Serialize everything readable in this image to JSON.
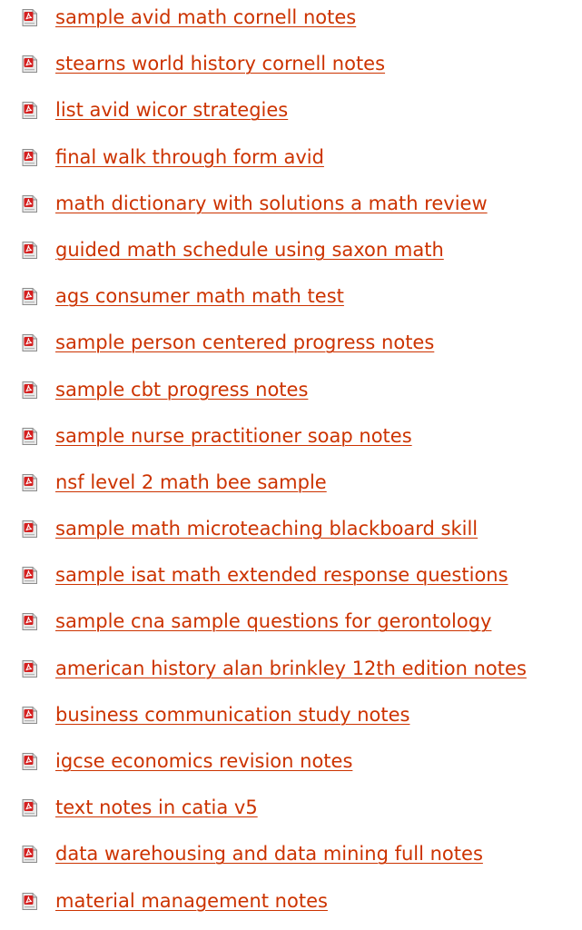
{
  "colors": {
    "link": "#cc3300",
    "icon_red": "#d41f1f",
    "icon_page": "#e9e9e9"
  },
  "icon": "pdf-document-icon",
  "documents": [
    "sample avid math cornell notes",
    "stearns world history cornell notes",
    "list avid wicor strategies",
    "final walk through form avid",
    "math dictionary with solutions a math review",
    "guided math schedule using saxon math",
    "ags consumer math math test",
    "sample person centered progress notes",
    "sample cbt progress notes",
    "sample nurse practitioner soap notes",
    "nsf level 2 math bee sample",
    "sample math microteaching blackboard skill",
    "sample isat math extended response questions",
    "sample cna sample questions for gerontology",
    "american history alan brinkley 12th edition notes",
    "business communication study notes",
    "igcse economics revision notes",
    "text notes in catia v5",
    "data warehousing and data mining full notes",
    "material management notes"
  ]
}
